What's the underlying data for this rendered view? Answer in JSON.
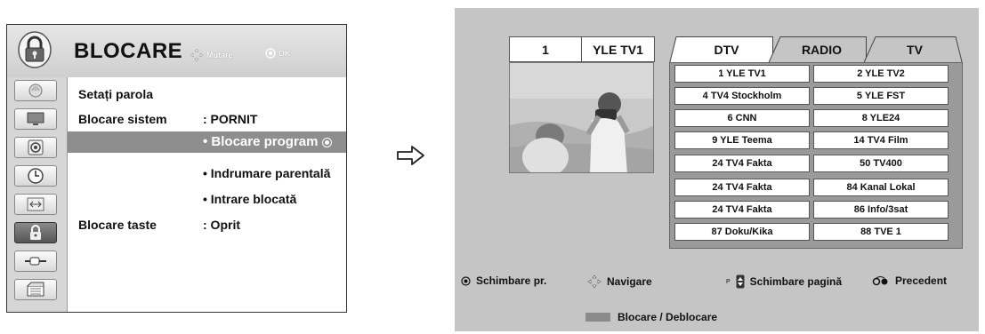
{
  "menu": {
    "title": "BLOCARE",
    "hint_move": "Mutare",
    "hint_ok": "OK",
    "rows": [
      {
        "label": "Setați parola",
        "value": ""
      },
      {
        "label": "Blocare sistem",
        "value": ": PORNIT"
      },
      {
        "label": "",
        "value": "• Blocare program"
      },
      {
        "label": "",
        "value": "• Indrumare parentală"
      },
      {
        "label": "",
        "value": "• Intrare blocată"
      },
      {
        "label": "Blocare taste",
        "value": ": Oprit"
      }
    ],
    "side_icons": [
      "picture-icon",
      "screen-icon",
      "audio-icon",
      "time-icon",
      "option-icon",
      "lock-icon",
      "input-icon",
      "usb-icon"
    ]
  },
  "channel_list": {
    "current_number": "1",
    "current_name": "YLE TV1",
    "tabs": [
      "DTV",
      "RADIO",
      "TV"
    ],
    "channels": [
      [
        "1 YLE TV1",
        "2 YLE TV2"
      ],
      [
        "4 TV4 Stockholm",
        "5 YLE FST"
      ],
      [
        "6 CNN",
        "8 YLE24"
      ],
      [
        "9 YLE Teema",
        "14 TV4 Film"
      ],
      [
        "24 TV4 Fakta",
        "50 TV400"
      ],
      [
        "24 TV4 Fakta",
        "84 Kanal Lokal"
      ],
      [
        "24 TV4 Fakta",
        "86 Info/3sat"
      ],
      [
        "87 Doku/Kika",
        "88 TVE 1"
      ]
    ],
    "footer": {
      "change": "Schimbare pr.",
      "navigate": "Navigare",
      "page_key": "P",
      "page": "Schimbare pagină",
      "back": "Precedent",
      "lock": "Blocare / Deblocare"
    }
  },
  "colors": {
    "panel_bg": "#c5c5c5",
    "grid_bg": "#9a9a9a",
    "selected_row": "#8e8e8e"
  }
}
